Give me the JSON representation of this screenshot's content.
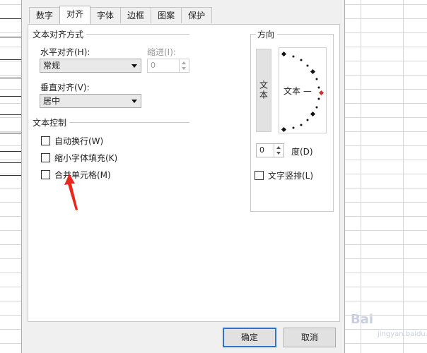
{
  "tabs": [
    {
      "label": "数字"
    },
    {
      "label": "对齐",
      "active": true
    },
    {
      "label": "字体"
    },
    {
      "label": "边框"
    },
    {
      "label": "图案"
    },
    {
      "label": "保护"
    }
  ],
  "text_alignment": {
    "group_title": "文本对齐方式",
    "horizontal_label": "水平对齐(H):",
    "horizontal_value": "常规",
    "indent_label": "缩进(I):",
    "indent_value": "0",
    "vertical_label": "垂直对齐(V):",
    "vertical_value": "居中"
  },
  "text_control": {
    "group_title": "文本控制",
    "options": [
      {
        "label": "自动换行(W)",
        "checked": false
      },
      {
        "label": "缩小字体填充(K)",
        "checked": false
      },
      {
        "label": "合并单元格(M)",
        "checked": false
      }
    ]
  },
  "orientation": {
    "group_title": "方向",
    "vertical_text_button": "文本",
    "dial_text": "文本 —",
    "degree_value": "0",
    "degree_label": "度(D)",
    "vertical_arrangement_label": "文字竖排(L)"
  },
  "buttons": {
    "ok": "确定",
    "cancel": "取消"
  },
  "watermark": {
    "brand": "Bai",
    "sub": "jingyan.baidu.com"
  },
  "colors": {
    "accent": "#2f72c9",
    "annotation": "#e8281e",
    "dial_marker": "#c0392b",
    "sheet_highlight": "#2e9a3a"
  }
}
